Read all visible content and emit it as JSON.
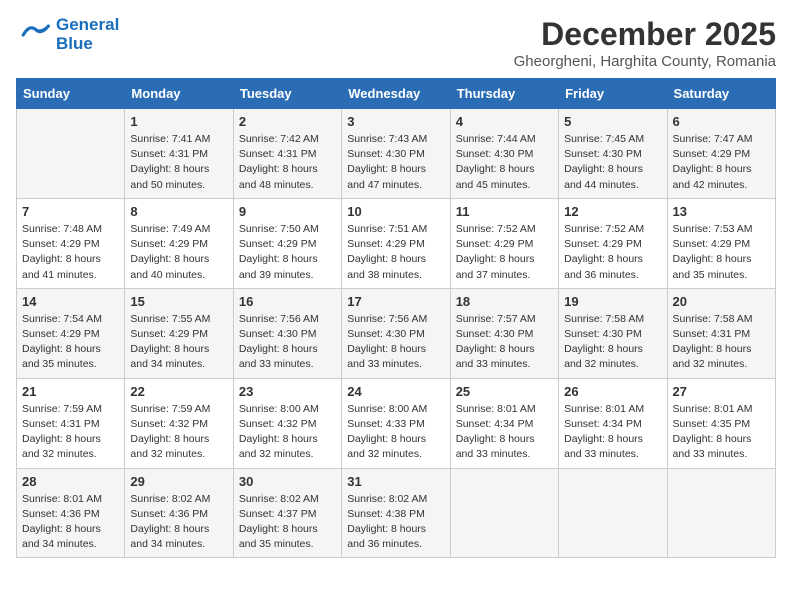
{
  "logo": {
    "line1": "General",
    "line2": "Blue"
  },
  "title": "December 2025",
  "subtitle": "Gheorgheni, Harghita County, Romania",
  "weekdays": [
    "Sunday",
    "Monday",
    "Tuesday",
    "Wednesday",
    "Thursday",
    "Friday",
    "Saturday"
  ],
  "weeks": [
    [
      {
        "day": "",
        "info": ""
      },
      {
        "day": "1",
        "info": "Sunrise: 7:41 AM\nSunset: 4:31 PM\nDaylight: 8 hours\nand 50 minutes."
      },
      {
        "day": "2",
        "info": "Sunrise: 7:42 AM\nSunset: 4:31 PM\nDaylight: 8 hours\nand 48 minutes."
      },
      {
        "day": "3",
        "info": "Sunrise: 7:43 AM\nSunset: 4:30 PM\nDaylight: 8 hours\nand 47 minutes."
      },
      {
        "day": "4",
        "info": "Sunrise: 7:44 AM\nSunset: 4:30 PM\nDaylight: 8 hours\nand 45 minutes."
      },
      {
        "day": "5",
        "info": "Sunrise: 7:45 AM\nSunset: 4:30 PM\nDaylight: 8 hours\nand 44 minutes."
      },
      {
        "day": "6",
        "info": "Sunrise: 7:47 AM\nSunset: 4:29 PM\nDaylight: 8 hours\nand 42 minutes."
      }
    ],
    [
      {
        "day": "7",
        "info": "Sunrise: 7:48 AM\nSunset: 4:29 PM\nDaylight: 8 hours\nand 41 minutes."
      },
      {
        "day": "8",
        "info": "Sunrise: 7:49 AM\nSunset: 4:29 PM\nDaylight: 8 hours\nand 40 minutes."
      },
      {
        "day": "9",
        "info": "Sunrise: 7:50 AM\nSunset: 4:29 PM\nDaylight: 8 hours\nand 39 minutes."
      },
      {
        "day": "10",
        "info": "Sunrise: 7:51 AM\nSunset: 4:29 PM\nDaylight: 8 hours\nand 38 minutes."
      },
      {
        "day": "11",
        "info": "Sunrise: 7:52 AM\nSunset: 4:29 PM\nDaylight: 8 hours\nand 37 minutes."
      },
      {
        "day": "12",
        "info": "Sunrise: 7:52 AM\nSunset: 4:29 PM\nDaylight: 8 hours\nand 36 minutes."
      },
      {
        "day": "13",
        "info": "Sunrise: 7:53 AM\nSunset: 4:29 PM\nDaylight: 8 hours\nand 35 minutes."
      }
    ],
    [
      {
        "day": "14",
        "info": "Sunrise: 7:54 AM\nSunset: 4:29 PM\nDaylight: 8 hours\nand 35 minutes."
      },
      {
        "day": "15",
        "info": "Sunrise: 7:55 AM\nSunset: 4:29 PM\nDaylight: 8 hours\nand 34 minutes."
      },
      {
        "day": "16",
        "info": "Sunrise: 7:56 AM\nSunset: 4:30 PM\nDaylight: 8 hours\nand 33 minutes."
      },
      {
        "day": "17",
        "info": "Sunrise: 7:56 AM\nSunset: 4:30 PM\nDaylight: 8 hours\nand 33 minutes."
      },
      {
        "day": "18",
        "info": "Sunrise: 7:57 AM\nSunset: 4:30 PM\nDaylight: 8 hours\nand 33 minutes."
      },
      {
        "day": "19",
        "info": "Sunrise: 7:58 AM\nSunset: 4:30 PM\nDaylight: 8 hours\nand 32 minutes."
      },
      {
        "day": "20",
        "info": "Sunrise: 7:58 AM\nSunset: 4:31 PM\nDaylight: 8 hours\nand 32 minutes."
      }
    ],
    [
      {
        "day": "21",
        "info": "Sunrise: 7:59 AM\nSunset: 4:31 PM\nDaylight: 8 hours\nand 32 minutes."
      },
      {
        "day": "22",
        "info": "Sunrise: 7:59 AM\nSunset: 4:32 PM\nDaylight: 8 hours\nand 32 minutes."
      },
      {
        "day": "23",
        "info": "Sunrise: 8:00 AM\nSunset: 4:32 PM\nDaylight: 8 hours\nand 32 minutes."
      },
      {
        "day": "24",
        "info": "Sunrise: 8:00 AM\nSunset: 4:33 PM\nDaylight: 8 hours\nand 32 minutes."
      },
      {
        "day": "25",
        "info": "Sunrise: 8:01 AM\nSunset: 4:34 PM\nDaylight: 8 hours\nand 33 minutes."
      },
      {
        "day": "26",
        "info": "Sunrise: 8:01 AM\nSunset: 4:34 PM\nDaylight: 8 hours\nand 33 minutes."
      },
      {
        "day": "27",
        "info": "Sunrise: 8:01 AM\nSunset: 4:35 PM\nDaylight: 8 hours\nand 33 minutes."
      }
    ],
    [
      {
        "day": "28",
        "info": "Sunrise: 8:01 AM\nSunset: 4:36 PM\nDaylight: 8 hours\nand 34 minutes."
      },
      {
        "day": "29",
        "info": "Sunrise: 8:02 AM\nSunset: 4:36 PM\nDaylight: 8 hours\nand 34 minutes."
      },
      {
        "day": "30",
        "info": "Sunrise: 8:02 AM\nSunset: 4:37 PM\nDaylight: 8 hours\nand 35 minutes."
      },
      {
        "day": "31",
        "info": "Sunrise: 8:02 AM\nSunset: 4:38 PM\nDaylight: 8 hours\nand 36 minutes."
      },
      {
        "day": "",
        "info": ""
      },
      {
        "day": "",
        "info": ""
      },
      {
        "day": "",
        "info": ""
      }
    ]
  ]
}
